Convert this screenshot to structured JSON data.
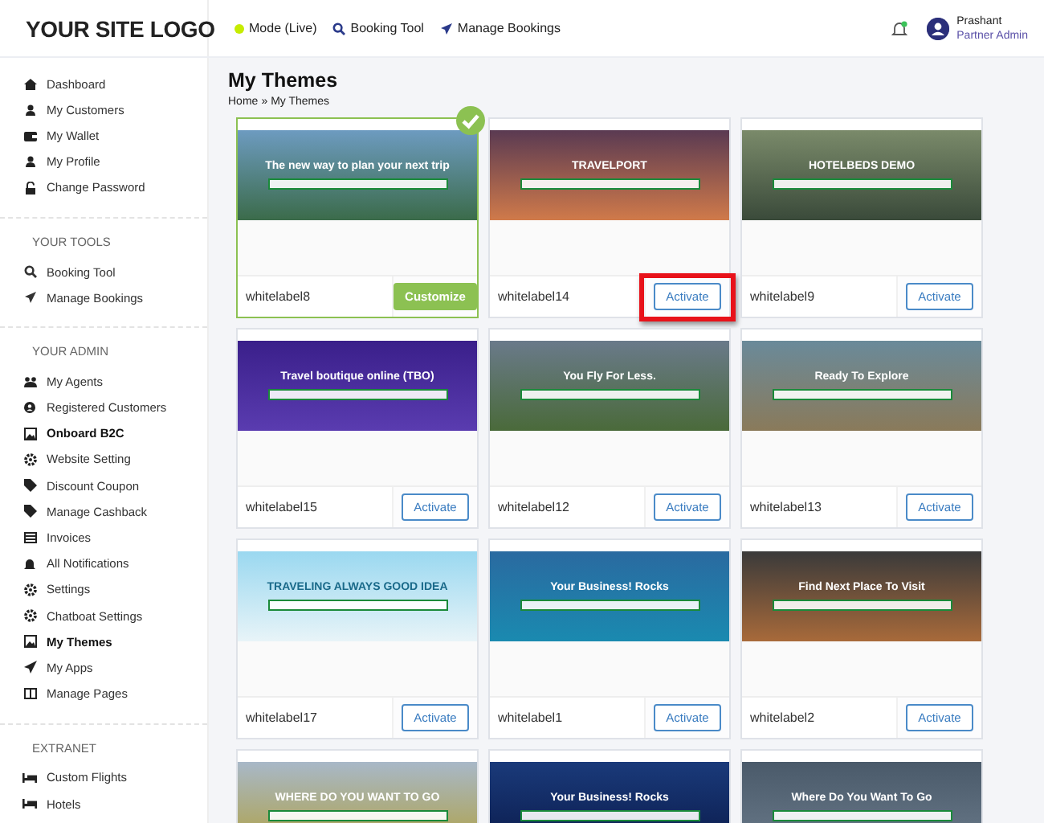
{
  "header": {
    "logo": "YOUR SITE LOGO",
    "nav": [
      {
        "label": "Mode (Live)"
      },
      {
        "label": "Booking Tool"
      },
      {
        "label": "Manage Bookings"
      }
    ],
    "notifications": {
      "unread": true
    },
    "user": {
      "name": "Prashant",
      "role": "Partner Admin"
    }
  },
  "sidebar": {
    "sections": [
      {
        "items": [
          {
            "label": "Dashboard",
            "bold": false
          },
          {
            "label": "My Customers",
            "bold": false
          },
          {
            "label": "My Wallet",
            "bold": false
          },
          {
            "label": "My Profile",
            "bold": false
          },
          {
            "label": "Change Password",
            "bold": false
          }
        ]
      },
      {
        "title": "YOUR TOOLS",
        "items": [
          {
            "label": "Booking Tool",
            "bold": false
          },
          {
            "label": "Manage Bookings",
            "bold": false
          }
        ]
      },
      {
        "title": "YOUR ADMIN",
        "items": [
          {
            "label": "My Agents",
            "bold": false
          },
          {
            "label": "Registered Customers",
            "bold": false
          },
          {
            "label": "Onboard B2C",
            "bold": true
          },
          {
            "label": "Website Setting",
            "bold": false
          },
          {
            "label": "Discount Coupon",
            "bold": false
          },
          {
            "label": "Manage Cashback",
            "bold": false
          },
          {
            "label": "Invoices",
            "bold": false
          },
          {
            "label": "All Notifications",
            "bold": false
          },
          {
            "label": "Settings",
            "bold": false
          },
          {
            "label": "Chatboat Settings",
            "bold": false
          },
          {
            "label": "My Themes",
            "bold": true
          },
          {
            "label": "My Apps",
            "bold": false
          },
          {
            "label": "Manage Pages",
            "bold": false
          }
        ]
      },
      {
        "title": "EXTRANET",
        "items": [
          {
            "label": "Custom Flights",
            "bold": false
          },
          {
            "label": "Hotels",
            "bold": false
          }
        ]
      }
    ]
  },
  "page": {
    "title": "My Themes",
    "breadcrumb": [
      {
        "label": "Home"
      },
      {
        "label": "My Themes"
      }
    ],
    "separator": "»"
  },
  "themes": [
    {
      "name": "whitelabel8",
      "headline": "The new way to plan your next trip",
      "active": true,
      "highlighted": false,
      "button": "Customize"
    },
    {
      "name": "whitelabel14",
      "headline": "TRAVELPORT",
      "active": false,
      "highlighted": true,
      "button": "Activate"
    },
    {
      "name": "whitelabel9",
      "headline": "HOTELBEDS DEMO",
      "active": false,
      "highlighted": false,
      "button": "Activate"
    },
    {
      "name": "whitelabel15",
      "headline": "Travel boutique online (TBO)",
      "active": false,
      "highlighted": false,
      "button": "Activate"
    },
    {
      "name": "whitelabel12",
      "headline": "You Fly For Less.",
      "active": false,
      "highlighted": false,
      "button": "Activate"
    },
    {
      "name": "whitelabel13",
      "headline": "Ready To Explore",
      "active": false,
      "highlighted": false,
      "button": "Activate"
    },
    {
      "name": "whitelabel17",
      "headline": "TRAVELING ALWAYS GOOD IDEA",
      "active": false,
      "highlighted": false,
      "button": "Activate"
    },
    {
      "name": "whitelabel1",
      "headline": "Your Business! Rocks",
      "active": false,
      "highlighted": false,
      "button": "Activate"
    },
    {
      "name": "whitelabel2",
      "headline": "Find Next Place To Visit",
      "active": false,
      "highlighted": false,
      "button": "Activate"
    }
  ],
  "partial_themes": [
    {
      "headline": "WHERE DO YOU WANT TO GO"
    },
    {
      "headline": "Your Business! Rocks"
    },
    {
      "headline": "Where Do You Want To Go"
    }
  ]
}
